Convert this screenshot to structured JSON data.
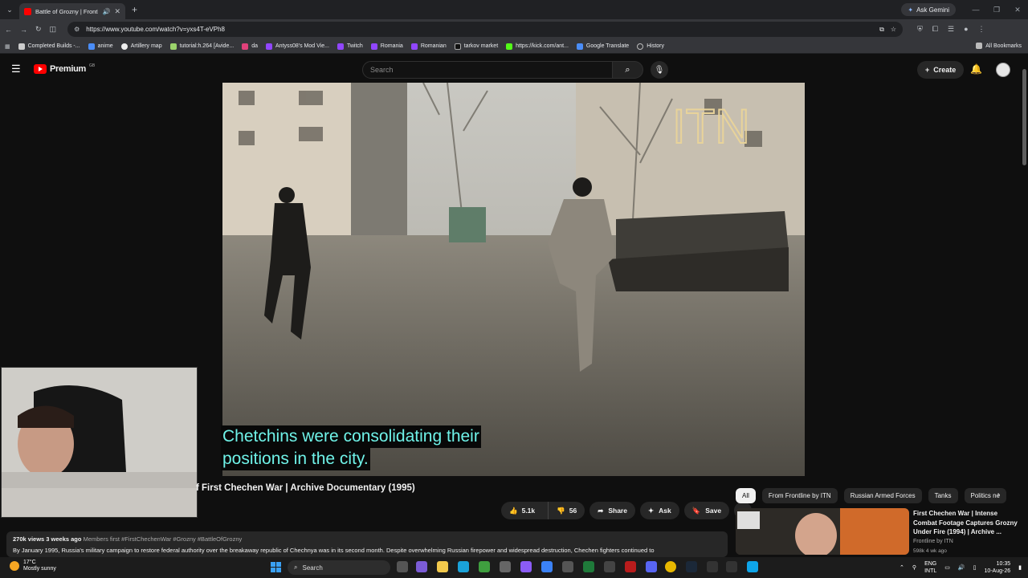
{
  "browser": {
    "tab_title": "Battle of Grozny | Frontline",
    "new_tab": "+",
    "ask_gemini": "Ask Gemini",
    "url": "https://www.youtube.com/watch?v=yxs4T-eVPh8",
    "bookmarks": [
      "Completed Builds -...",
      "anime",
      "Artillery map",
      "tutorial:h.264 [Avide...",
      "da",
      "Antyss08's Mod Vie...",
      "Twitch",
      "Romania",
      "Romanian",
      "tarkov market",
      "https://kick.com/ant...",
      "Google Translate",
      "History"
    ],
    "all_bookmarks": "All Bookmarks"
  },
  "youtube": {
    "logo_text": "Premium",
    "logo_region": "GB",
    "search_placeholder": "Search",
    "create_label": "Create"
  },
  "video": {
    "caption_line1": "Chetchins were consolidating their",
    "caption_line2": "positions in the city.",
    "watermark": "ITN",
    "title": "f First Chechen War | Archive Documentary (1995)",
    "likes": "5.1k",
    "dislikes": "56",
    "share": "Share",
    "ask": "Ask",
    "save": "Save",
    "meta": "270k views  3 weeks ago",
    "meta_tags": "Members first  #FirstChechenWar #Grozny #BattleOfGrozny",
    "description": "By January 1995, Russia's military campaign to restore federal authority over the breakaway republic of Chechnya was in its second month. Despite overwhelming Russian firepower and widespread destruction, Chechen fighters continued to"
  },
  "sidebar": {
    "chips": [
      "All",
      "From Frontline by ITN",
      "Russian Armed Forces",
      "Tanks",
      "Politics ne"
    ],
    "related": {
      "title": "First Chechen War | Intense Combat Footage Captures Grozny Under Fire (1994) | Archive ...",
      "channel": "Frontline by ITN",
      "meta": "598k  4 wk ago"
    }
  },
  "taskbar": {
    "temp": "17°C",
    "weather": "Mostly sunny",
    "search": "Search",
    "lang1": "ENG",
    "lang2": "INTL",
    "time": "10:35",
    "date": "10-Aug-26"
  }
}
